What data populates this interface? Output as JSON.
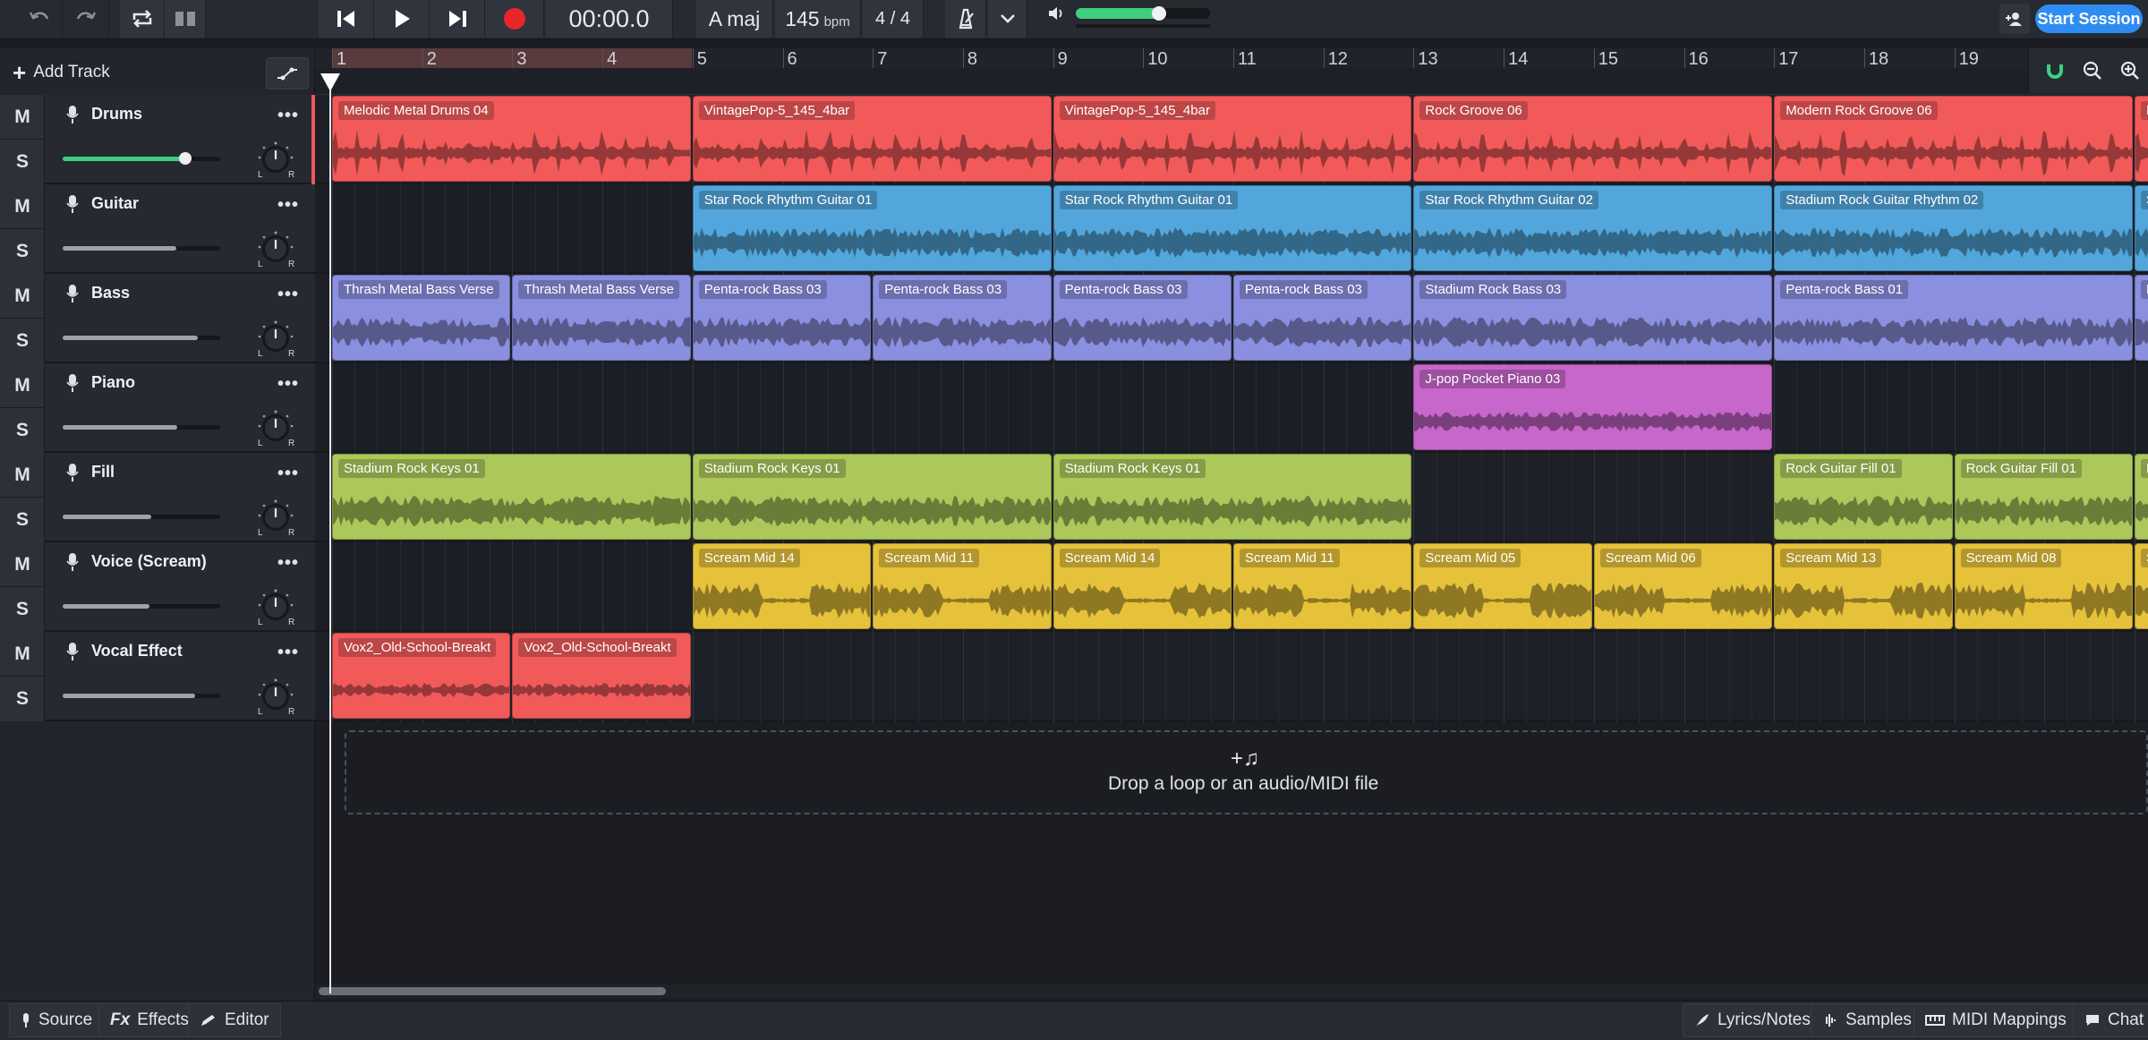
{
  "transport": {
    "time": "00:00.0",
    "key": "A maj",
    "tempo_value": "145",
    "tempo_unit": "bpm",
    "time_signature": "4 / 4",
    "master_volume": 0.62
  },
  "session": {
    "start_label": "Start Session"
  },
  "left_panel": {
    "add_track_label": "Add Track"
  },
  "tracks": [
    {
      "name": "Drums",
      "mute": "M",
      "solo": "S",
      "volume": 0.78,
      "color": "#f25a5a"
    },
    {
      "name": "Guitar",
      "mute": "M",
      "solo": "S",
      "volume": 0.72,
      "color": "#52a6dc"
    },
    {
      "name": "Bass",
      "mute": "M",
      "solo": "S",
      "volume": 0.86,
      "color": "#8a8fdf"
    },
    {
      "name": "Piano",
      "mute": "M",
      "solo": "S",
      "volume": 0.73,
      "color": "#c766cb"
    },
    {
      "name": "Fill",
      "mute": "M",
      "solo": "S",
      "volume": 0.56,
      "color": "#adc85a"
    },
    {
      "name": "Voice (Scream)",
      "mute": "M",
      "solo": "S",
      "volume": 0.55,
      "color": "#e6c23a"
    },
    {
      "name": "Vocal Effect",
      "mute": "M",
      "solo": "S",
      "volume": 0.84,
      "color": "#f25a5a"
    }
  ],
  "ruler": {
    "bars": [
      "1",
      "2",
      "3",
      "4",
      "5",
      "6",
      "7",
      "8",
      "9",
      "10",
      "11",
      "12",
      "13",
      "14",
      "15",
      "16",
      "17",
      "18",
      "19"
    ]
  },
  "clips": [
    [
      {
        "label": "Melodic Metal Drums 04",
        "start": 1,
        "end": 5
      },
      {
        "label": "VintagePop-5_145_4bar",
        "start": 5,
        "end": 9
      },
      {
        "label": "VintagePop-5_145_4bar",
        "start": 9,
        "end": 13
      },
      {
        "label": "Rock Groove 06",
        "start": 13,
        "end": 17
      },
      {
        "label": "Modern Rock Groove 06",
        "start": 17,
        "end": 21
      },
      {
        "label": "M",
        "start": 21,
        "end": 23
      }
    ],
    [
      {
        "label": "Star Rock Rhythm Guitar 01",
        "start": 5,
        "end": 9
      },
      {
        "label": "Star Rock Rhythm Guitar 01",
        "start": 9,
        "end": 13
      },
      {
        "label": "Star Rock Rhythm Guitar 02",
        "start": 13,
        "end": 17
      },
      {
        "label": "Stadium Rock Guitar Rhythm 02",
        "start": 17,
        "end": 21
      },
      {
        "label": "S",
        "start": 21,
        "end": 23
      }
    ],
    [
      {
        "label": "Thrash Metal Bass Verse",
        "start": 1,
        "end": 3
      },
      {
        "label": "Thrash Metal Bass Verse",
        "start": 3,
        "end": 5
      },
      {
        "label": "Penta-rock Bass 03",
        "start": 5,
        "end": 7
      },
      {
        "label": "Penta-rock Bass 03",
        "start": 7,
        "end": 9
      },
      {
        "label": "Penta-rock Bass 03",
        "start": 9,
        "end": 11
      },
      {
        "label": "Penta-rock Bass 03",
        "start": 11,
        "end": 13
      },
      {
        "label": "Stadium Rock Bass 03",
        "start": 13,
        "end": 17
      },
      {
        "label": "Penta-rock Bass 01",
        "start": 17,
        "end": 21
      },
      {
        "label": "P",
        "start": 21,
        "end": 23
      }
    ],
    [
      {
        "label": "J-pop Pocket Piano 03",
        "start": 13,
        "end": 17
      }
    ],
    [
      {
        "label": "Stadium Rock Keys 01",
        "start": 1,
        "end": 5
      },
      {
        "label": "Stadium Rock Keys 01",
        "start": 5,
        "end": 9
      },
      {
        "label": "Stadium Rock Keys 01",
        "start": 9,
        "end": 13
      },
      {
        "label": "Rock Guitar Fill 01",
        "start": 17,
        "end": 19
      },
      {
        "label": "Rock Guitar Fill 01",
        "start": 19,
        "end": 21
      },
      {
        "label": "R",
        "start": 21,
        "end": 23
      }
    ],
    [
      {
        "label": "Scream Mid 14",
        "start": 5,
        "end": 7
      },
      {
        "label": "Scream Mid 11",
        "start": 7,
        "end": 9
      },
      {
        "label": "Scream Mid 14",
        "start": 9,
        "end": 11
      },
      {
        "label": "Scream Mid 11",
        "start": 11,
        "end": 13
      },
      {
        "label": "Scream Mid 05",
        "start": 13,
        "end": 15
      },
      {
        "label": "Scream Mid 06",
        "start": 15,
        "end": 17
      },
      {
        "label": "Scream Mid 13",
        "start": 17,
        "end": 19
      },
      {
        "label": "Scream Mid 08",
        "start": 19,
        "end": 21
      },
      {
        "label": "S",
        "start": 21,
        "end": 23
      }
    ],
    [
      {
        "label": "Vox2_Old-School-Breakt",
        "start": 1,
        "end": 3
      },
      {
        "label": "Vox2_Old-School-Breakt",
        "start": 3,
        "end": 5
      }
    ]
  ],
  "dropzone": {
    "icon": "+♫",
    "text": "Drop a loop or an audio/MIDI file"
  },
  "bottom_left": {
    "source": "Source",
    "effects": "Effects",
    "effects_prefix": "Fx",
    "editor": "Editor"
  },
  "bottom_right": {
    "lyrics": "Lyrics/Notes",
    "samples": "Samples",
    "midi": "MIDI Mappings",
    "chat": "Chat"
  },
  "colors": {
    "accent": "#2f8cf0",
    "record": "#e8262a",
    "volume_green": "#3fcf7f"
  }
}
